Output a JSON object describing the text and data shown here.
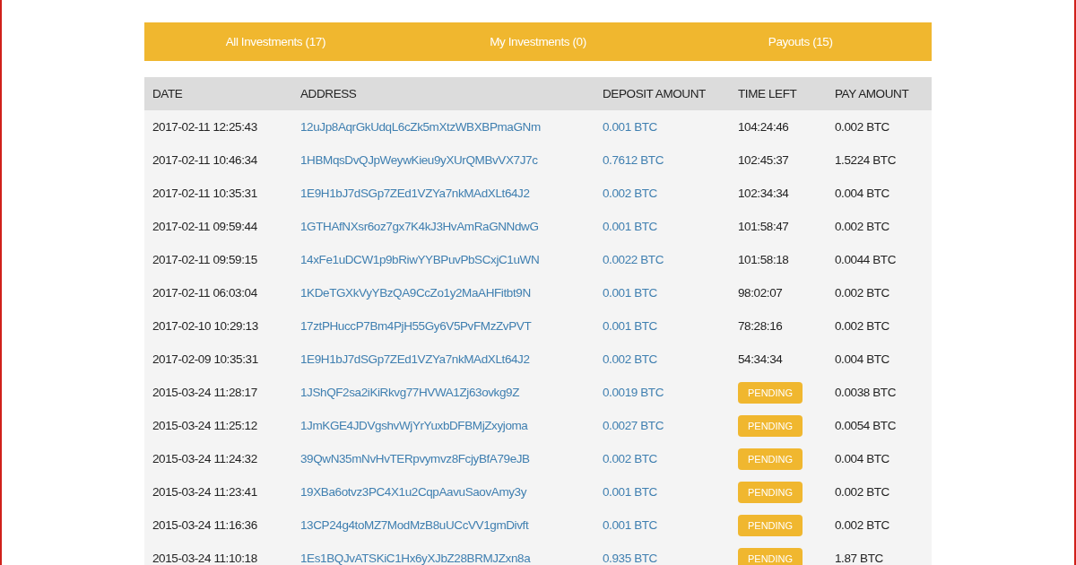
{
  "tabs": [
    {
      "label": "All Investments (17)",
      "selected": false
    },
    {
      "label": "My Investments (0)",
      "selected": false
    },
    {
      "label": "Payouts (15)",
      "selected": false
    }
  ],
  "table": {
    "columns": [
      "DATE",
      "ADDRESS",
      "DEPOSIT AMOUNT",
      "TIME LEFT",
      "PAY AMOUNT"
    ],
    "rows": [
      {
        "date": "2017-02-11 12:25:43",
        "address": "12uJp8AqrGkUdqL6cZk5mXtzWBXBPmaGNm",
        "deposit": "0.001 BTC",
        "time_left": {
          "kind": "countdown",
          "text": "104:24:46"
        },
        "pay": "0.002 BTC"
      },
      {
        "date": "2017-02-11 10:46:34",
        "address": "1HBMqsDvQJpWeywKieu9yXUrQMBvVX7J7c",
        "deposit": "0.7612 BTC",
        "time_left": {
          "kind": "countdown",
          "text": "102:45:37"
        },
        "pay": "1.5224 BTC"
      },
      {
        "date": "2017-02-11 10:35:31",
        "address": "1E9H1bJ7dSGp7ZEd1VZYa7nkMAdXLt64J2",
        "deposit": "0.002 BTC",
        "time_left": {
          "kind": "countdown",
          "text": "102:34:34"
        },
        "pay": "0.004 BTC"
      },
      {
        "date": "2017-02-11 09:59:44",
        "address": "1GTHAfNXsr6oz7gx7K4kJ3HvAmRaGNNdwG",
        "deposit": "0.001 BTC",
        "time_left": {
          "kind": "countdown",
          "text": "101:58:47"
        },
        "pay": "0.002 BTC"
      },
      {
        "date": "2017-02-11 09:59:15",
        "address": "14xFe1uDCW1p9bRiwYYBPuvPbSCxjC1uWN",
        "deposit": "0.0022 BTC",
        "time_left": {
          "kind": "countdown",
          "text": "101:58:18"
        },
        "pay": "0.0044 BTC"
      },
      {
        "date": "2017-02-11 06:03:04",
        "address": "1KDeTGXkVyYBzQA9CcZo1y2MaAHFitbt9N",
        "deposit": "0.001 BTC",
        "time_left": {
          "kind": "countdown",
          "text": "98:02:07"
        },
        "pay": "0.002 BTC"
      },
      {
        "date": "2017-02-10 10:29:13",
        "address": "17ztPHuccP7Bm4PjH55Gy6V5PvFMzZvPVT",
        "deposit": "0.001 BTC",
        "time_left": {
          "kind": "countdown",
          "text": "78:28:16"
        },
        "pay": "0.002 BTC"
      },
      {
        "date": "2017-02-09 10:35:31",
        "address": "1E9H1bJ7dSGp7ZEd1VZYa7nkMAdXLt64J2",
        "deposit": "0.002 BTC",
        "time_left": {
          "kind": "countdown",
          "text": "54:34:34"
        },
        "pay": "0.004 BTC"
      },
      {
        "date": "2015-03-24 11:28:17",
        "address": "1JShQF2sa2iKiRkvg77HVWA1Zj63ovkg9Z",
        "deposit": "0.0019 BTC",
        "time_left": {
          "kind": "status",
          "text": "PENDING"
        },
        "pay": "0.0038 BTC"
      },
      {
        "date": "2015-03-24 11:25:12",
        "address": "1JmKGE4JDVgshvWjYrYuxbDFBMjZxyjoma",
        "deposit": "0.0027 BTC",
        "time_left": {
          "kind": "status",
          "text": "PENDING"
        },
        "pay": "0.0054 BTC"
      },
      {
        "date": "2015-03-24 11:24:32",
        "address": "39QwN35mNvHvTERpvymvz8FcjyBfA79eJB",
        "deposit": "0.002 BTC",
        "time_left": {
          "kind": "status",
          "text": "PENDING"
        },
        "pay": "0.004 BTC"
      },
      {
        "date": "2015-03-24 11:23:41",
        "address": "19XBa6otvz3PC4X1u2CqpAavuSaovAmy3y",
        "deposit": "0.001 BTC",
        "time_left": {
          "kind": "status",
          "text": "PENDING"
        },
        "pay": "0.002 BTC"
      },
      {
        "date": "2015-03-24 11:16:36",
        "address": "13CP24g4toMZ7ModMzB8uUCcVV1gmDivft",
        "deposit": "0.001 BTC",
        "time_left": {
          "kind": "status",
          "text": "PENDING"
        },
        "pay": "0.002 BTC"
      },
      {
        "date": "2015-03-24 11:10:18",
        "address": "1Es1BQJvATSKiC1Hx6yXJbZ28BRMJZxn8a",
        "deposit": "0.935 BTC",
        "time_left": {
          "kind": "status",
          "text": "PENDING"
        },
        "pay": "1.87 BTC"
      }
    ]
  }
}
